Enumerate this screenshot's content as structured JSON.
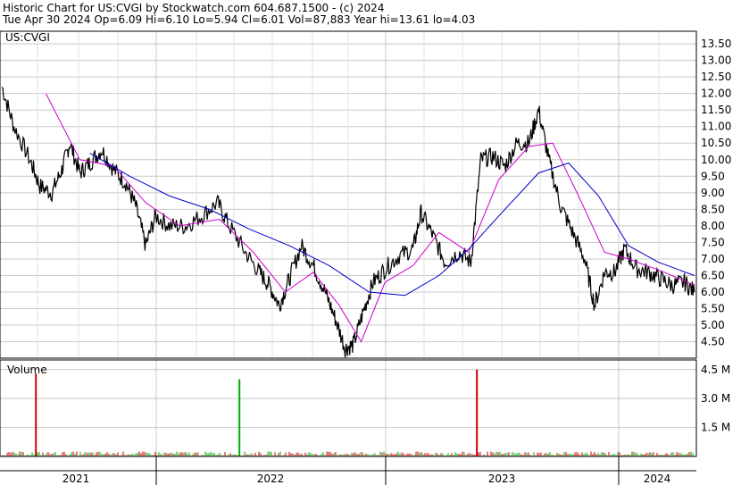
{
  "header": {
    "line1": "Historic Chart for US:CVGI by Stockwatch.com 604.687.1500 - (c) 2024",
    "line2": "Tue Apr 30 2024  Op=6.09  Hi=6.10  Lo=5.94  Cl=6.01  Vol=87,883  Year hi=13.61  lo=4.03"
  },
  "colors": {
    "price": "#000000",
    "ma_fast": "#cc00cc",
    "ma_slow": "#0000cc",
    "grid": "#c8c8c8",
    "vol_up": "#00aa00",
    "vol_down": "#cc0000"
  },
  "chart_data": [
    {
      "type": "line",
      "label": "US:CVGI",
      "ylim": [
        4.03,
        13.61
      ],
      "y_ticks": [
        "13.50",
        "13.00",
        "12.50",
        "12.00",
        "11.50",
        "11.00",
        "10.50",
        "10.00",
        "9.50",
        "9.00",
        "8.50",
        "8.00",
        "7.50",
        "7.00",
        "6.50",
        "6.00",
        "5.50",
        "5.00",
        "4.50"
      ],
      "x_labels": [
        "2021",
        "2022",
        "2023",
        "2024"
      ],
      "grid": true,
      "price_path": [
        {
          "x": 2020.86,
          "y": 12.2
        },
        {
          "x": 2020.92,
          "y": 11.0
        },
        {
          "x": 2021.0,
          "y": 10.0
        },
        {
          "x": 2021.05,
          "y": 9.2
        },
        {
          "x": 2021.11,
          "y": 9.0
        },
        {
          "x": 2021.16,
          "y": 9.7
        },
        {
          "x": 2021.2,
          "y": 10.5
        },
        {
          "x": 2021.25,
          "y": 9.6
        },
        {
          "x": 2021.3,
          "y": 9.9
        },
        {
          "x": 2021.36,
          "y": 10.3
        },
        {
          "x": 2021.42,
          "y": 9.7
        },
        {
          "x": 2021.48,
          "y": 9.3
        },
        {
          "x": 2021.53,
          "y": 8.6
        },
        {
          "x": 2021.58,
          "y": 7.4
        },
        {
          "x": 2021.63,
          "y": 8.3
        },
        {
          "x": 2021.7,
          "y": 8.0
        },
        {
          "x": 2021.78,
          "y": 8.0
        },
        {
          "x": 2021.86,
          "y": 8.3
        },
        {
          "x": 2021.94,
          "y": 8.7
        },
        {
          "x": 2022.0,
          "y": 8.0
        },
        {
          "x": 2022.08,
          "y": 7.2
        },
        {
          "x": 2022.15,
          "y": 6.6
        },
        {
          "x": 2022.2,
          "y": 6.2
        },
        {
          "x": 2022.25,
          "y": 5.6
        },
        {
          "x": 2022.3,
          "y": 6.4
        },
        {
          "x": 2022.36,
          "y": 7.4
        },
        {
          "x": 2022.42,
          "y": 6.8
        },
        {
          "x": 2022.48,
          "y": 6.0
        },
        {
          "x": 2022.53,
          "y": 5.2
        },
        {
          "x": 2022.58,
          "y": 4.3
        },
        {
          "x": 2022.62,
          "y": 4.4
        },
        {
          "x": 2022.67,
          "y": 5.4
        },
        {
          "x": 2022.72,
          "y": 6.3
        },
        {
          "x": 2022.78,
          "y": 6.7
        },
        {
          "x": 2022.85,
          "y": 7.1
        },
        {
          "x": 2022.92,
          "y": 7.3
        },
        {
          "x": 2022.96,
          "y": 8.4
        },
        {
          "x": 2023.02,
          "y": 7.7
        },
        {
          "x": 2023.08,
          "y": 6.9
        },
        {
          "x": 2023.15,
          "y": 7.2
        },
        {
          "x": 2023.21,
          "y": 6.9
        },
        {
          "x": 2023.26,
          "y": 10.0
        },
        {
          "x": 2023.32,
          "y": 10.1
        },
        {
          "x": 2023.38,
          "y": 9.8
        },
        {
          "x": 2023.44,
          "y": 10.5
        },
        {
          "x": 2023.5,
          "y": 10.5
        },
        {
          "x": 2023.55,
          "y": 11.5
        },
        {
          "x": 2023.6,
          "y": 10.0
        },
        {
          "x": 2023.66,
          "y": 8.6
        },
        {
          "x": 2023.72,
          "y": 7.8
        },
        {
          "x": 2023.78,
          "y": 7.0
        },
        {
          "x": 2023.83,
          "y": 5.6
        },
        {
          "x": 2023.88,
          "y": 6.6
        },
        {
          "x": 2023.93,
          "y": 6.6
        },
        {
          "x": 2023.98,
          "y": 7.3
        },
        {
          "x": 2024.04,
          "y": 6.7
        },
        {
          "x": 2024.1,
          "y": 6.6
        },
        {
          "x": 2024.16,
          "y": 6.4
        },
        {
          "x": 2024.22,
          "y": 6.2
        },
        {
          "x": 2024.28,
          "y": 6.3
        },
        {
          "x": 2024.33,
          "y": 6.0
        }
      ],
      "ma_fast": [
        {
          "x": 2021.08,
          "y": 12.0
        },
        {
          "x": 2021.25,
          "y": 10.0
        },
        {
          "x": 2021.42,
          "y": 9.8
        },
        {
          "x": 2021.58,
          "y": 8.7
        },
        {
          "x": 2021.75,
          "y": 8.0
        },
        {
          "x": 2021.95,
          "y": 8.2
        },
        {
          "x": 2022.12,
          "y": 7.2
        },
        {
          "x": 2022.28,
          "y": 6.0
        },
        {
          "x": 2022.42,
          "y": 6.6
        },
        {
          "x": 2022.55,
          "y": 5.6
        },
        {
          "x": 2022.66,
          "y": 4.5
        },
        {
          "x": 2022.78,
          "y": 6.3
        },
        {
          "x": 2022.92,
          "y": 6.8
        },
        {
          "x": 2023.05,
          "y": 7.8
        },
        {
          "x": 2023.2,
          "y": 7.2
        },
        {
          "x": 2023.35,
          "y": 9.4
        },
        {
          "x": 2023.5,
          "y": 10.4
        },
        {
          "x": 2023.62,
          "y": 10.5
        },
        {
          "x": 2023.75,
          "y": 8.9
        },
        {
          "x": 2023.88,
          "y": 7.2
        },
        {
          "x": 2024.0,
          "y": 7.0
        },
        {
          "x": 2024.18,
          "y": 6.6
        },
        {
          "x": 2024.33,
          "y": 6.2
        }
      ],
      "ma_slow": [
        {
          "x": 2021.3,
          "y": 10.2
        },
        {
          "x": 2021.5,
          "y": 9.5
        },
        {
          "x": 2021.7,
          "y": 8.9
        },
        {
          "x": 2021.9,
          "y": 8.5
        },
        {
          "x": 2022.1,
          "y": 7.9
        },
        {
          "x": 2022.3,
          "y": 7.4
        },
        {
          "x": 2022.5,
          "y": 6.8
        },
        {
          "x": 2022.7,
          "y": 6.0
        },
        {
          "x": 2022.88,
          "y": 5.9
        },
        {
          "x": 2023.05,
          "y": 6.5
        },
        {
          "x": 2023.2,
          "y": 7.3
        },
        {
          "x": 2023.35,
          "y": 8.3
        },
        {
          "x": 2023.55,
          "y": 9.6
        },
        {
          "x": 2023.7,
          "y": 9.9
        },
        {
          "x": 2023.85,
          "y": 8.9
        },
        {
          "x": 2024.0,
          "y": 7.4
        },
        {
          "x": 2024.15,
          "y": 6.9
        },
        {
          "x": 2024.33,
          "y": 6.5
        }
      ]
    },
    {
      "type": "bar",
      "label": "Volume",
      "ylim": [
        0,
        5.0
      ],
      "unit": "M",
      "y_ticks": [
        "4.5 M",
        "3.0 M",
        "1.5 M"
      ],
      "baseline_volume_M": 0.15,
      "spikes": [
        {
          "x": 2021.03,
          "value": 4.3,
          "color": "down"
        },
        {
          "x": 2022.05,
          "value": 4.0,
          "color": "up"
        },
        {
          "x": 2023.24,
          "value": 4.5,
          "color": "down"
        }
      ]
    }
  ]
}
